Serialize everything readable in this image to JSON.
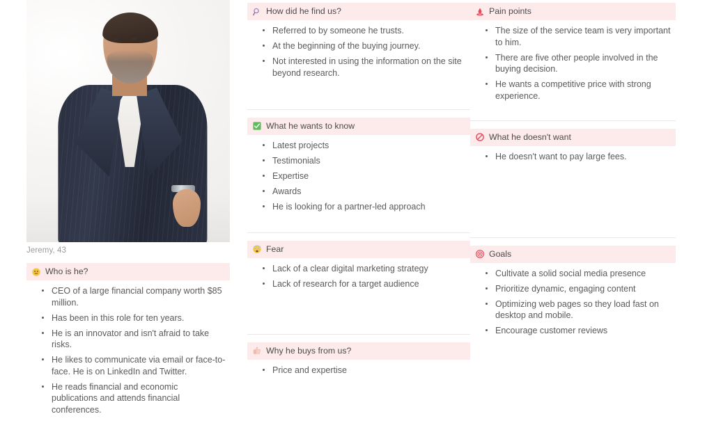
{
  "colors": {
    "header_bg": "#fdeaeb",
    "text": "#5a5a5a",
    "caption": "#9a9a9a",
    "separator": "#e8e8e8",
    "accent_red": "#e8495a",
    "accent_green": "#5bbd5b",
    "accent_yellow": "#f5c542"
  },
  "persona": {
    "photo_caption": "Jeremy, 43",
    "photo_alt": "Portrait of Jeremy, a man in a dark navy pinstripe suit"
  },
  "left_column": {
    "sections": [
      {
        "icon": "neutral-face-emoji",
        "title": "Who is he?",
        "items": [
          "CEO of a large financial company worth $85 million.",
          "Has been in this role for ten years.",
          "He is an innovator and isn't afraid to take risks.",
          "He likes to communicate via email or face-to-face. He is on LinkedIn and Twitter.",
          "He reads financial and economic publications and attends financial conferences."
        ]
      }
    ]
  },
  "middle_column": {
    "sections": [
      {
        "icon": "magnifying-glass-icon",
        "title": "How did he find us?",
        "items": [
          "Referred to by someone he trusts.",
          "At the beginning of the buying journey.",
          "Not interested in using the information on the site beyond research."
        ]
      },
      {
        "icon": "green-check-icon",
        "title": "What he wants to know",
        "items": [
          "Latest projects",
          "Testimonials",
          "Expertise",
          "Awards",
          "He is looking for a partner-led approach"
        ]
      },
      {
        "icon": "fearful-face-emoji",
        "title": "Fear",
        "items": [
          "Lack of a clear digital marketing strategy",
          "Lack of research for a target audience"
        ]
      },
      {
        "icon": "thumbs-up-icon",
        "title": "Why he buys from us?",
        "items": [
          "Price and expertise"
        ]
      }
    ]
  },
  "right_column": {
    "sections": [
      {
        "icon": "pain-icon",
        "title": "Pain points",
        "items": [
          "The size of the service team is very important to him.",
          "There are five other people involved in the buying decision.",
          "He wants a competitive price with strong experience."
        ]
      },
      {
        "icon": "prohibited-icon",
        "title": "What he doesn't want",
        "items": [
          "He doesn't want to pay large fees."
        ]
      },
      {
        "icon": "target-icon",
        "title": "Goals",
        "items": [
          "Cultivate a solid social media presence",
          "Prioritize dynamic, engaging content",
          "Optimizing web pages so they load fast on desktop and mobile.",
          "Encourage customer reviews"
        ]
      }
    ]
  }
}
